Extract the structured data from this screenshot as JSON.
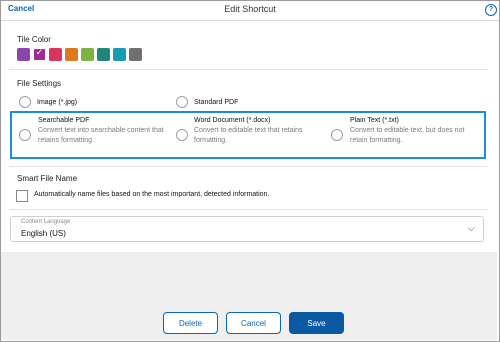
{
  "header": {
    "cancel_label": "Cancel",
    "title": "Edit Shortcut",
    "help_icon": "?"
  },
  "tile_color": {
    "label": "Tile Color",
    "swatches": [
      {
        "color": "#8e44ad",
        "selected": false
      },
      {
        "color": "#a02c8f",
        "selected": true
      },
      {
        "color": "#d6375b",
        "selected": false
      },
      {
        "color": "#d97a1e",
        "selected": false
      },
      {
        "color": "#7cb342",
        "selected": false
      },
      {
        "color": "#20857a",
        "selected": false
      },
      {
        "color": "#1b9bb0",
        "selected": false
      },
      {
        "color": "#6f6f6f",
        "selected": false
      }
    ],
    "check_glyph": "✓"
  },
  "file_settings": {
    "label": "File Settings",
    "options": [
      {
        "title": "Image (*.jpg)",
        "desc": ""
      },
      {
        "title": "Standard PDF",
        "desc": ""
      },
      {
        "title": "Searchable PDF",
        "desc": "Convert text into searchable content that retains formatting."
      },
      {
        "title": "Word Document (*.docx)",
        "desc": "Convert to editable text that retains formatting."
      },
      {
        "title": "Plain Text (*.txt)",
        "desc": "Convert to editable text, but does not retain formatting."
      }
    ]
  },
  "smart_file_name": {
    "label": "Smart File Name",
    "checkbox_label": "Automatically name files based on the most important, detected information."
  },
  "content_language": {
    "label": "Content Language",
    "value": "English (US)",
    "chevron": "⌵"
  },
  "footer": {
    "delete_label": "Delete",
    "cancel_label": "Cancel",
    "save_label": "Save"
  }
}
